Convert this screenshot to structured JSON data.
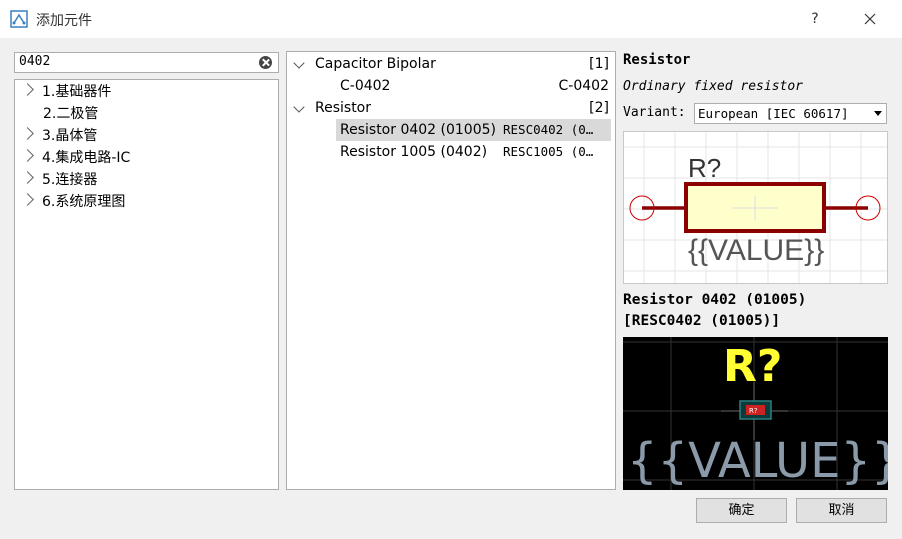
{
  "window": {
    "title": "添加元件",
    "help_label": "?"
  },
  "search": {
    "value": "0402"
  },
  "categories": [
    {
      "label": "1.基础器件",
      "expandable": true
    },
    {
      "label": "2.二极管",
      "expandable": false
    },
    {
      "label": "3.晶体管",
      "expandable": true
    },
    {
      "label": "4.集成电路-IC",
      "expandable": true
    },
    {
      "label": "5.连接器",
      "expandable": true
    },
    {
      "label": "6.系统原理图",
      "expandable": true
    }
  ],
  "tree": {
    "groups": [
      {
        "label": "Capacitor Bipolar",
        "count": "[1]",
        "items": [
          {
            "name": "C-0402",
            "footprint": "C-0402"
          }
        ]
      },
      {
        "label": "Resistor",
        "count": "[2]",
        "items": [
          {
            "name": "Resistor 0402 (01005)",
            "footprint": "RESC0402 (0…",
            "selected": true
          },
          {
            "name": "Resistor 1005 (0402)",
            "footprint": "RESC1005 (0…"
          }
        ]
      }
    ]
  },
  "preview": {
    "title": "Resistor",
    "description": "Ordinary fixed resistor",
    "variant_label": "Variant:",
    "variant_value": "European [IEC 60617]",
    "symbol_ref": "R?",
    "symbol_value": "{{VALUE}}",
    "part_name_line1": "Resistor 0402 (01005)",
    "part_name_line2": "[RESC0402 (01005)]",
    "footprint_ref": "R?",
    "footprint_value": "{{VALUE}}",
    "pad_label": "R?"
  },
  "buttons": {
    "ok": "确定",
    "cancel": "取消"
  },
  "colors": {
    "resistor_body": "#8b0000",
    "resistor_fill": "#ffffcc",
    "pin": "#cc0000",
    "pcb_ref": "#ffff33",
    "pcb_value": "#8a9aa8",
    "selection": "#d9d9d9"
  }
}
